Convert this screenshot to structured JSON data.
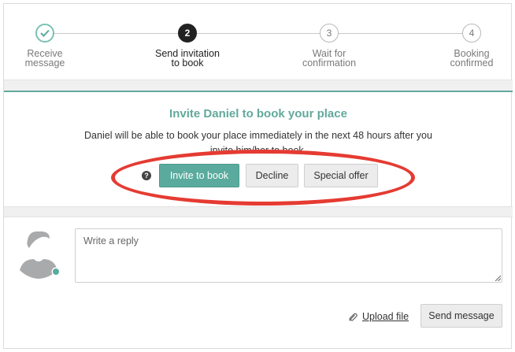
{
  "stepper": {
    "steps": [
      {
        "number": "✓",
        "label": "Receive\nmessage",
        "state": "done"
      },
      {
        "number": "2",
        "label": "Send invitation\nto book",
        "state": "active"
      },
      {
        "number": "3",
        "label": "Wait for\nconfirmation",
        "state": "pending"
      },
      {
        "number": "4",
        "label": "Booking\nconfirmed",
        "state": "pending"
      }
    ]
  },
  "invite": {
    "title": "Invite Daniel to book your place",
    "description": "Daniel will be able to book your place immediately in the next 48 hours after you invite him/her to book.",
    "help_icon": "?",
    "invite_label": "Invite to book",
    "decline_label": "Decline",
    "special_offer_label": "Special offer"
  },
  "reply": {
    "placeholder": "Write a reply",
    "upload_label": "Upload file",
    "send_label": "Send message"
  },
  "colors": {
    "accent": "#5aab9d",
    "highlight_ring": "#e53b32",
    "online_dot": "#5aab9d"
  },
  "icons": {
    "done": "check-icon",
    "help": "question-icon",
    "attachment": "paperclip-icon",
    "avatar": "user-avatar-icon"
  }
}
